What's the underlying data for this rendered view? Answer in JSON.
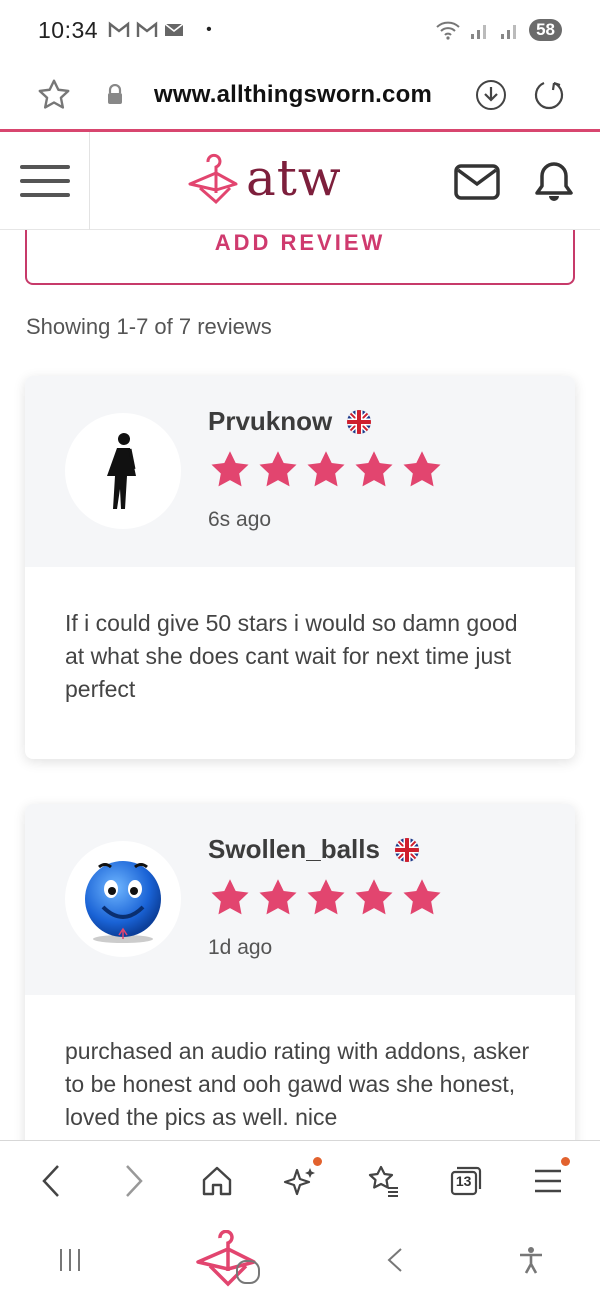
{
  "status_bar": {
    "time": "10:34",
    "notif_icons": [
      "gmail-icon",
      "gmail-icon",
      "mail-icon"
    ],
    "dot": "•",
    "battery": "58"
  },
  "browser": {
    "url": "www.allthingsworn.com"
  },
  "site": {
    "logo_text": "atw",
    "brand_color": "#7d1f3c",
    "accent_color": "#e2456f"
  },
  "add_review_label": "ADD REVIEW",
  "showing_text": "Showing 1-7 of 7 reviews",
  "reviews": [
    {
      "name": "Prvuknow",
      "flag": "uk-flag-icon",
      "rating": 5,
      "time": "6s ago",
      "text": "If i could give 50 stars i would so damn good at what she does cant wait for next time just perfect",
      "avatar": "female-silhouette-icon"
    },
    {
      "name": "Swollen_balls",
      "flag": "uk-flag-icon",
      "rating": 5,
      "time": "1d ago",
      "text": "purchased an audio rating with addons, asker to be honest and ooh gawd was she honest, loved the pics as well. nice",
      "avatar": "blue-smiley-icon"
    }
  ],
  "browser_nav": {
    "tabs_count": "13"
  }
}
